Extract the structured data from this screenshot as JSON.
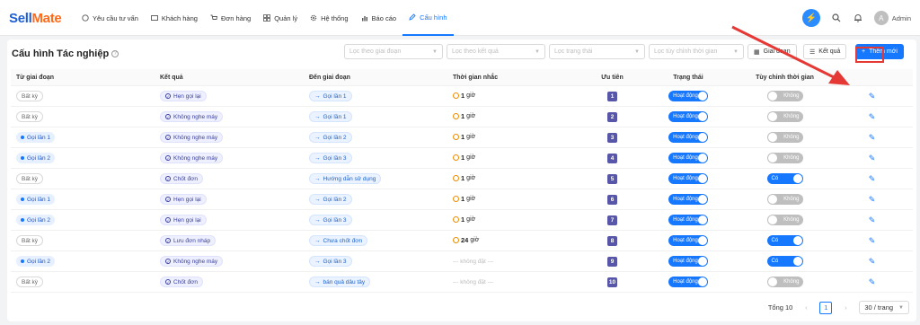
{
  "app": {
    "logo_a": "Sell",
    "logo_b": "Mate",
    "user": "Admin",
    "avatar_letter": "A"
  },
  "nav": [
    {
      "label": "Yêu cầu tư vấn",
      "icon": "chat-icon"
    },
    {
      "label": "Khách hàng",
      "icon": "id-card-icon"
    },
    {
      "label": "Đơn hàng",
      "icon": "cart-icon"
    },
    {
      "label": "Quản lý",
      "icon": "grid-icon"
    },
    {
      "label": "Hệ thống",
      "icon": "gear-icon"
    },
    {
      "label": "Báo cáo",
      "icon": "bar-chart-icon"
    },
    {
      "label": "Cấu hình",
      "icon": "pencil-icon",
      "active": true
    }
  ],
  "page": {
    "title": "Cấu hình Tác nghiệp",
    "help": "?"
  },
  "filters": {
    "stage": "Lọc theo giai đoạn",
    "result": "Lọc theo kết quả",
    "status": "Lọc trạng thái",
    "time": "Lọc tùy chỉnh thời gian"
  },
  "buttons": {
    "stage": "Giai đoạn",
    "result": "Kết quả",
    "add": "Thêm mới"
  },
  "columns": [
    "Từ giai đoạn",
    "Kết quả",
    "Đến giai đoạn",
    "Thời gian nhắc",
    "Ưu tiên",
    "Trạng thái",
    "Tùy chỉnh thời gian"
  ],
  "rows": [
    {
      "from": "Bất kỳ",
      "from_style": "gray",
      "result": "Hẹn gọi lại",
      "to": "Gọi lần 1",
      "time": "1",
      "unit": "giờ",
      "priority": "1",
      "status": "Hoạt động",
      "custom": "Không",
      "custom_on": false
    },
    {
      "from": "Bất kỳ",
      "from_style": "gray",
      "result": "Không nghe máy",
      "to": "Gọi lần 1",
      "time": "1",
      "unit": "giờ",
      "priority": "2",
      "status": "Hoạt động",
      "custom": "Không",
      "custom_on": false
    },
    {
      "from": "Gọi lần 1",
      "from_style": "blue",
      "result": "Không nghe máy",
      "to": "Gọi lần 2",
      "time": "1",
      "unit": "giờ",
      "priority": "3",
      "status": "Hoạt động",
      "custom": "Không",
      "custom_on": false
    },
    {
      "from": "Gọi lần 2",
      "from_style": "blue",
      "result": "Không nghe máy",
      "to": "Gọi lần 3",
      "time": "1",
      "unit": "giờ",
      "priority": "4",
      "status": "Hoạt động",
      "custom": "Không",
      "custom_on": false
    },
    {
      "from": "Bất kỳ",
      "from_style": "gray",
      "result": "Chốt đơn",
      "to": "Hướng dẫn sử dụng",
      "time": "1",
      "unit": "giờ",
      "priority": "5",
      "status": "Hoạt động",
      "custom": "Có",
      "custom_on": true
    },
    {
      "from": "Gọi lần 1",
      "from_style": "blue",
      "result": "Hẹn gọi lại",
      "to": "Gọi lần 2",
      "time": "1",
      "unit": "giờ",
      "priority": "6",
      "status": "Hoạt động",
      "custom": "Không",
      "custom_on": false
    },
    {
      "from": "Gọi lần 2",
      "from_style": "blue",
      "result": "Hẹn gọi lại",
      "to": "Gọi lần 3",
      "time": "1",
      "unit": "giờ",
      "priority": "7",
      "status": "Hoạt động",
      "custom": "Không",
      "custom_on": false
    },
    {
      "from": "Bất kỳ",
      "from_style": "gray",
      "result": "Lưu đơn nháp",
      "to": "Chưa chốt đơn",
      "time": "24",
      "unit": "giờ",
      "priority": "8",
      "status": "Hoạt động",
      "custom": "Có",
      "custom_on": true
    },
    {
      "from": "Gọi lần 2",
      "from_style": "blue",
      "result": "Không nghe máy",
      "to": "Gọi lần 3",
      "time": "",
      "unit": "",
      "no_time": "--- không đặt ---",
      "priority": "9",
      "status": "Hoạt động",
      "custom": "Có",
      "custom_on": true
    },
    {
      "from": "Bất kỳ",
      "from_style": "gray",
      "result": "Chốt đơn",
      "to": "bán quả dâu tây",
      "time": "",
      "unit": "",
      "no_time": "--- không đặt ---",
      "priority": "10",
      "status": "Hoạt động",
      "custom": "Không",
      "custom_on": false
    }
  ],
  "pagination": {
    "total": "Tổng 10",
    "page": "1",
    "size": "30 / trang"
  },
  "colors": {
    "primary": "#1677ff",
    "priority": "#5856a8",
    "highlight": "#e53935"
  }
}
